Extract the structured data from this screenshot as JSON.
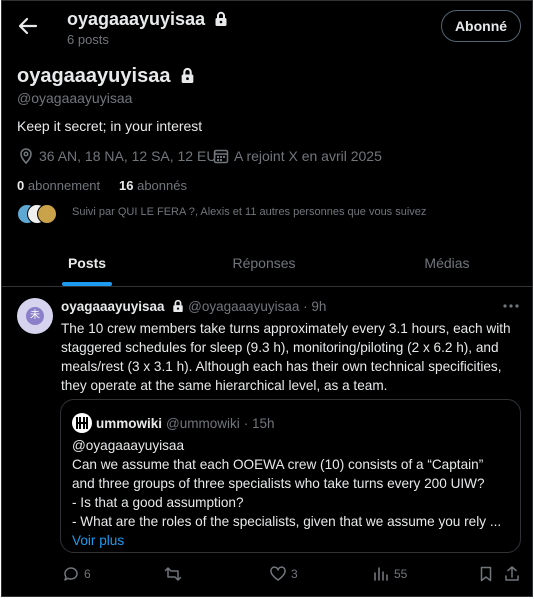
{
  "header": {
    "title": "oyagaaayuyisaa",
    "subtitle": "6 posts",
    "follow_button": "Abonné"
  },
  "profile": {
    "name": "oyagaaayuyisaa",
    "handle": "@oyagaaayuyisaa",
    "bio": "Keep it secret; in your interest",
    "location": "36 AN, 18 NA, 12 SA, 12 EU",
    "joined": "A rejoint X en avril 2025",
    "following_count": "0",
    "following_label": "abonnement",
    "followers_count": "16",
    "followers_label": "abonnés",
    "followed_by": "Suivi par QUI LE FERA ?, Alexis et 11 autres personnes que vous suivez"
  },
  "tabs": [
    {
      "label": "Posts",
      "active": true
    },
    {
      "label": "Réponses",
      "active": false
    },
    {
      "label": "Médias",
      "active": false
    }
  ],
  "post": {
    "author": "oyagaaayuyisaa",
    "handle": "@oyagaaayuyisaa",
    "time": "· 9h",
    "text": "The 10 crew members take turns approximately every 3.1 hours, each with staggered schedules for sleep (9.3 h), monitoring/piloting (2 x 6.2 h), and meals/rest (3 x 3.1 h). Although each has their own technical specificities, they operate at the same hierarchical level, as a team.",
    "quote": {
      "author": "ummowiki",
      "handle": "@ummowiki",
      "time": "· 15h",
      "lines": [
        "@oyagaaayuyisaa",
        "Can we assume that each OOEWA crew (10) consists of a “Captain”",
        "and three groups of three specialists who take turns every 200 UIW?",
        "- Is that a good assumption?",
        "- What are the roles of the specialists, given that we assume you rely ..."
      ],
      "more": "Voir plus"
    },
    "actions": {
      "replies": "6",
      "reposts": "",
      "likes": "3",
      "views": "55"
    }
  },
  "colors": {
    "background": "#000000",
    "text": "#e7e9ea",
    "muted": "#71767b",
    "accent": "#1d9bf0",
    "border": "#2f3336"
  }
}
